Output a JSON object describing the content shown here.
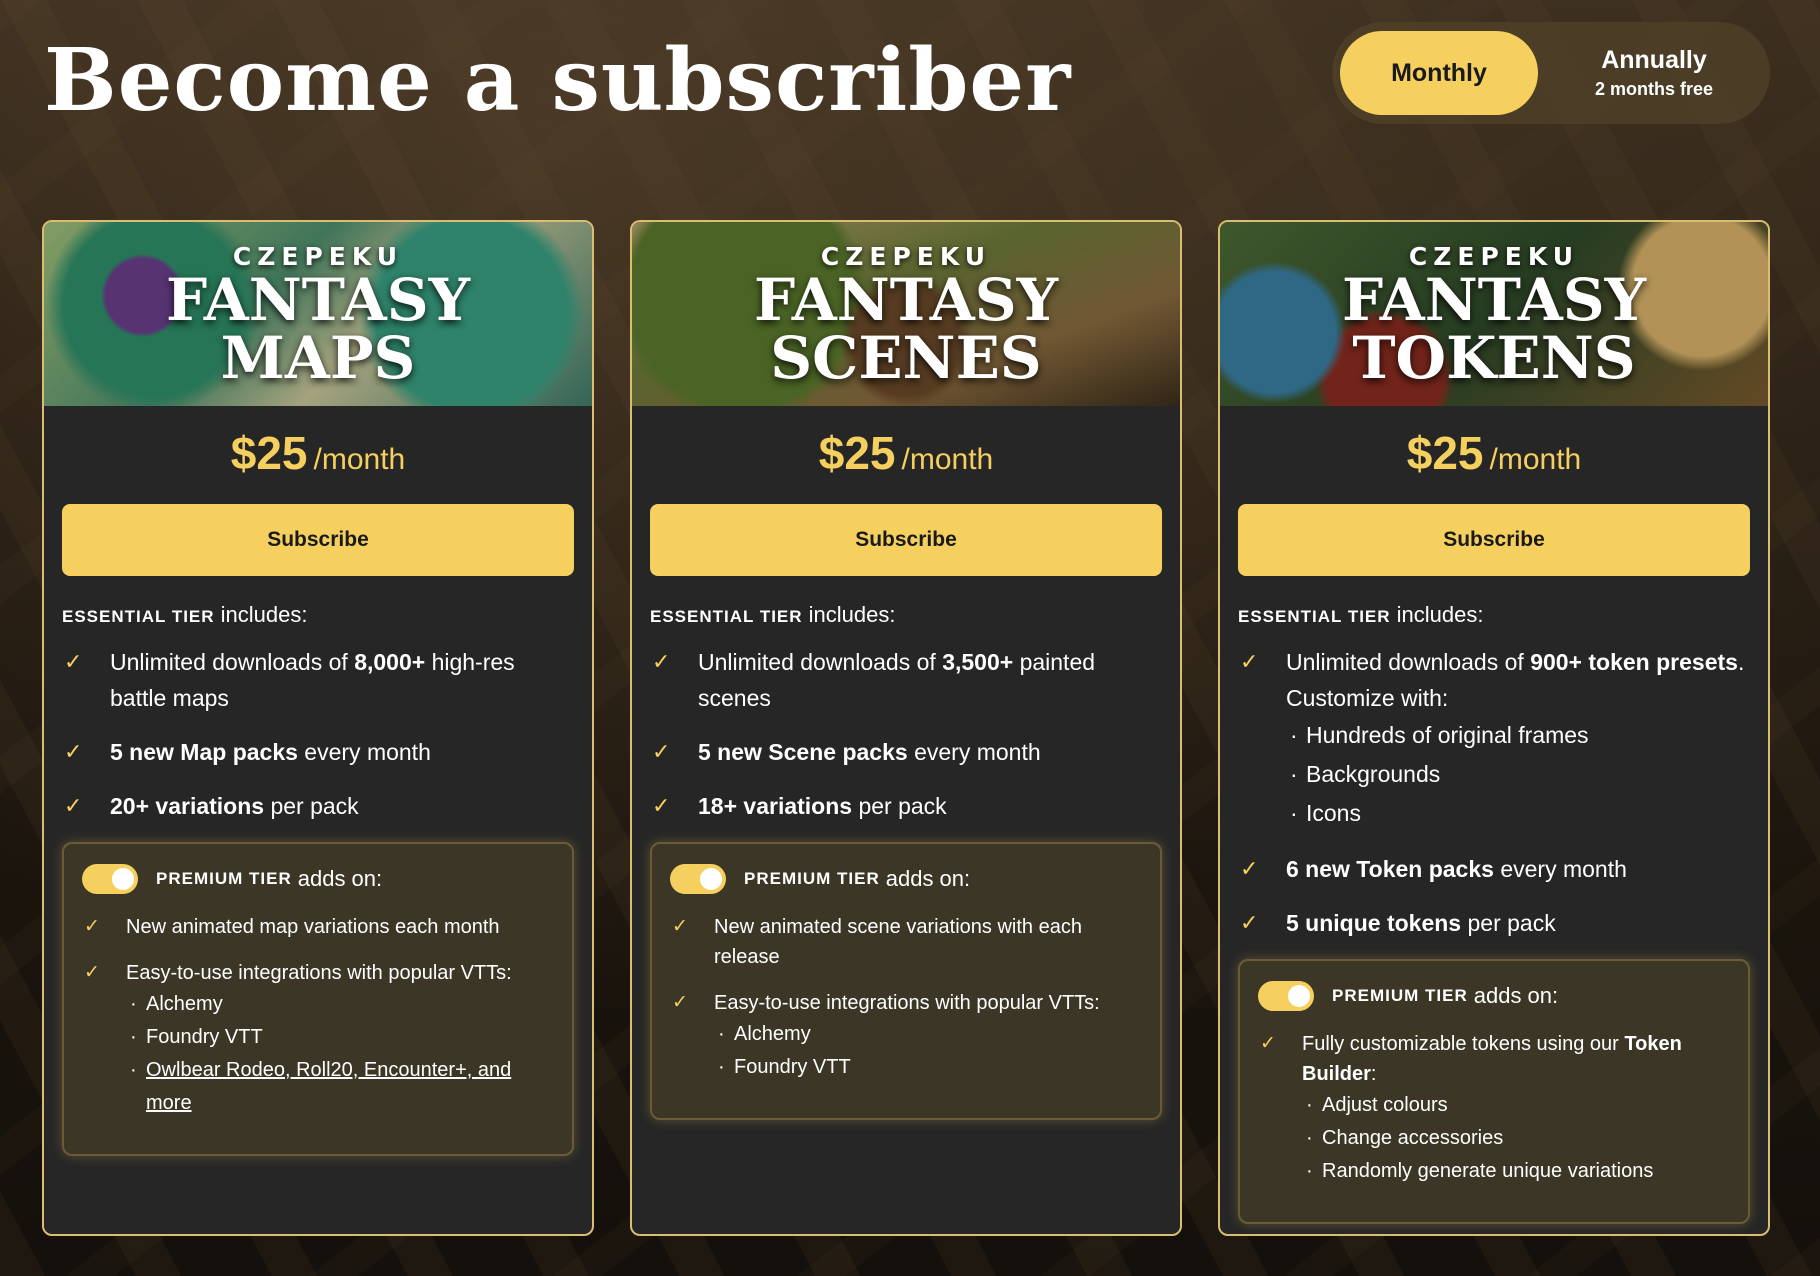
{
  "page": {
    "title": "Become a subscriber"
  },
  "billing_toggle": {
    "monthly_label": "Monthly",
    "annual_label": "Annually",
    "annual_note": "2 months free",
    "selected": "Monthly"
  },
  "colors": {
    "accent": "#f6d05e",
    "card_bg": "#262626",
    "card_border": "#d8bd72"
  },
  "cards": [
    {
      "brand": "CZEPEKU",
      "product_line1": "FANTASY",
      "product_line2": "MAPS",
      "price": "$25",
      "per": "/month",
      "subscribe_label": "Subscribe",
      "essential_tier": "ESSENTIAL TIER",
      "includes": "includes:",
      "features": [
        {
          "pre": "Unlimited downloads of ",
          "bold": "8,000+",
          "post": " high-res battle maps"
        },
        {
          "pre": "",
          "bold": "5 new Map packs",
          "post": " every month"
        },
        {
          "pre": "",
          "bold": "20+ variations",
          "post": " per pack"
        }
      ],
      "premium_tier": "PREMIUM TIER",
      "adds_on": "adds on:",
      "premium_features": [
        "New animated map variations each month",
        "Easy-to-use integrations with popular VTTs:"
      ],
      "premium_subitems": [
        "Alchemy",
        "Foundry VTT",
        "Owlbear Rodeo, Roll20, Encounter+, and more"
      ]
    },
    {
      "brand": "CZEPEKU",
      "product_line1": "FANTASY",
      "product_line2": "SCENES",
      "price": "$25",
      "per": "/month",
      "subscribe_label": "Subscribe",
      "essential_tier": "ESSENTIAL TIER",
      "includes": "includes:",
      "features": [
        {
          "pre": "Unlimited downloads of ",
          "bold": "3,500+",
          "post": " painted scenes"
        },
        {
          "pre": "",
          "bold": "5 new Scene packs",
          "post": " every month"
        },
        {
          "pre": "",
          "bold": "18+ variations",
          "post": " per pack"
        }
      ],
      "premium_tier": "PREMIUM TIER",
      "adds_on": "adds on:",
      "premium_features": [
        "New animated scene variations with each release",
        "Easy-to-use integrations with popular VTTs:"
      ],
      "premium_subitems": [
        "Alchemy",
        "Foundry VTT"
      ]
    },
    {
      "brand": "CZEPEKU",
      "product_line1": "FANTASY",
      "product_line2": "TOKENS",
      "price": "$25",
      "per": "/month",
      "subscribe_label": "Subscribe",
      "essential_tier": "ESSENTIAL TIER",
      "includes": "includes:",
      "feature1_pre": "Unlimited downloads of ",
      "feature1_bold": "900+ token presets",
      "feature1_post": ". Customize with:",
      "feature1_subitems": [
        "Hundreds of original frames",
        "Backgrounds",
        "Icons"
      ],
      "features": [
        {
          "pre": "",
          "bold": "6 new Token packs",
          "post": " every month"
        },
        {
          "pre": "",
          "bold": "5 unique tokens",
          "post": " per pack"
        }
      ],
      "premium_tier": "PREMIUM TIER",
      "adds_on": "adds on:",
      "premium_feature1_pre": "Fully customizable tokens using our ",
      "premium_feature1_bold": "Token Builder",
      "premium_feature1_post": ":",
      "premium_subitems": [
        "Adjust colours",
        "Change accessories",
        "Randomly generate unique variations"
      ]
    }
  ]
}
